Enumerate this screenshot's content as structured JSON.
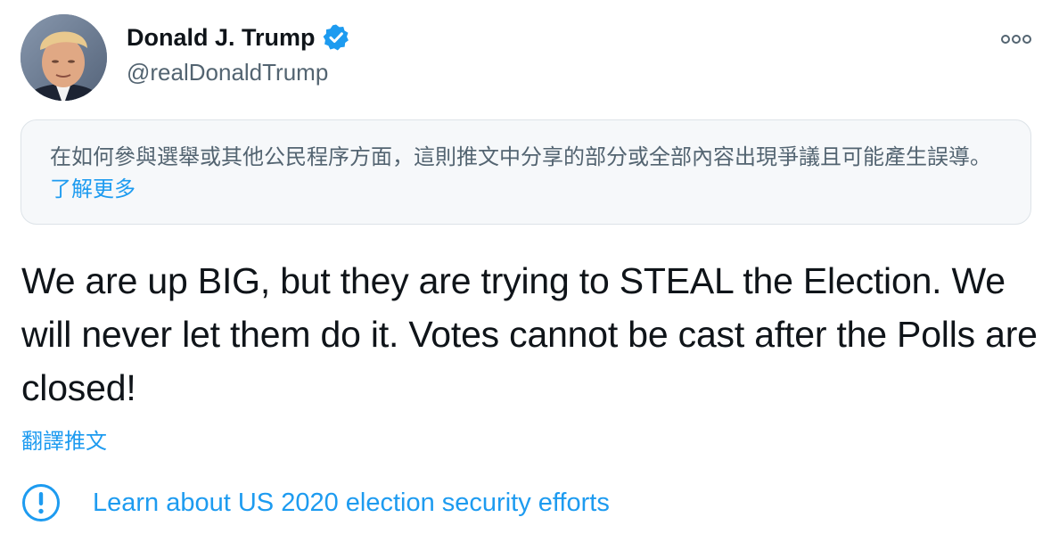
{
  "author": {
    "name": "Donald J. Trump",
    "handle": "@realDonaldTrump",
    "verified_icon": "verified-badge-icon",
    "avatar_icon": "profile-photo"
  },
  "menu": {
    "icon": "more-dots-icon"
  },
  "notice": {
    "text": "在如何參與選舉或其他公民程序方面，這則推文中分享的部分或全部內容出現爭議且可能產生誤導。",
    "link_label": "了解更多"
  },
  "tweet": {
    "text": "We are up BIG, but they are trying to STEAL the Election. We will never let them do it. Votes cannot be cast after the Polls are closed!"
  },
  "translate": {
    "label": "翻譯推文"
  },
  "election_info": {
    "icon": "exclamation-circle-icon",
    "label": "Learn about US 2020 election security efforts"
  },
  "colors": {
    "accent": "#1d9bf0",
    "text_primary": "#0f1419",
    "text_secondary": "#536471",
    "notice_background": "#f6f8fa"
  }
}
